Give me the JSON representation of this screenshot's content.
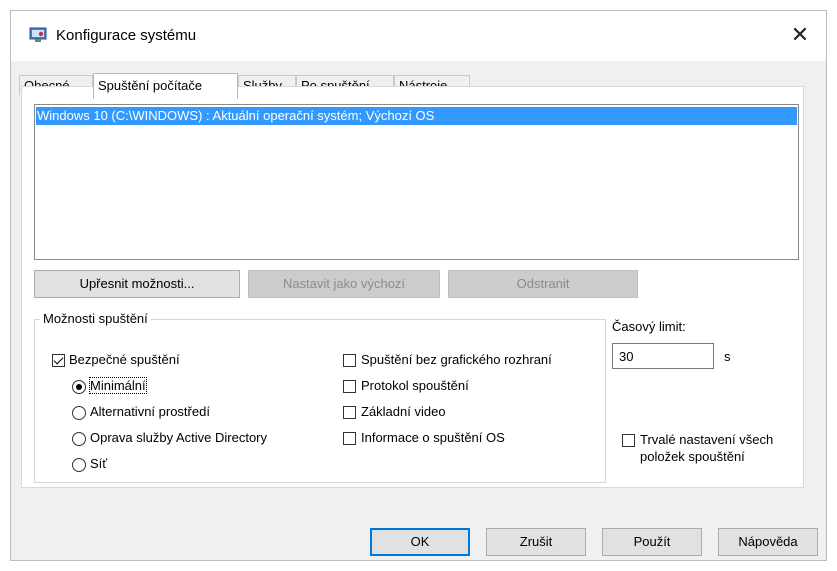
{
  "window": {
    "title": "Konfigurace systému"
  },
  "tabs": [
    {
      "label": "Obecné"
    },
    {
      "label": "Spuštění počítače"
    },
    {
      "label": "Služby"
    },
    {
      "label": "Po spuštění"
    },
    {
      "label": "Nástroje"
    }
  ],
  "os_list": {
    "items": [
      "Windows 10 (C:\\WINDOWS) : Aktuální operační systém; Výchozí OS"
    ]
  },
  "buttons": {
    "advanced": "Upřesnit možnosti...",
    "set_default": "Nastavit jako výchozí",
    "delete": "Odstranit"
  },
  "options": {
    "group_label": "Možnosti spuštění",
    "safe_boot": "Bezpečné spuštění",
    "minimal": "Minimální",
    "alternate_shell": "Alternativní prostředí",
    "ad_repair": "Oprava služby Active Directory",
    "network": "Síť",
    "no_gui": "Spuštění bez grafického rozhraní",
    "boot_log": "Protokol spouštění",
    "base_video": "Základní video",
    "os_info": "Informace o spuštění OS"
  },
  "timeout": {
    "label": "Časový limit:",
    "value": "30",
    "unit": "s"
  },
  "permanent": {
    "line1": "Trvalé nastavení všech",
    "line2": "položek spouštění"
  },
  "footer": {
    "ok": "OK",
    "cancel": "Zrušit",
    "apply": "Použít",
    "help": "Nápověda"
  }
}
